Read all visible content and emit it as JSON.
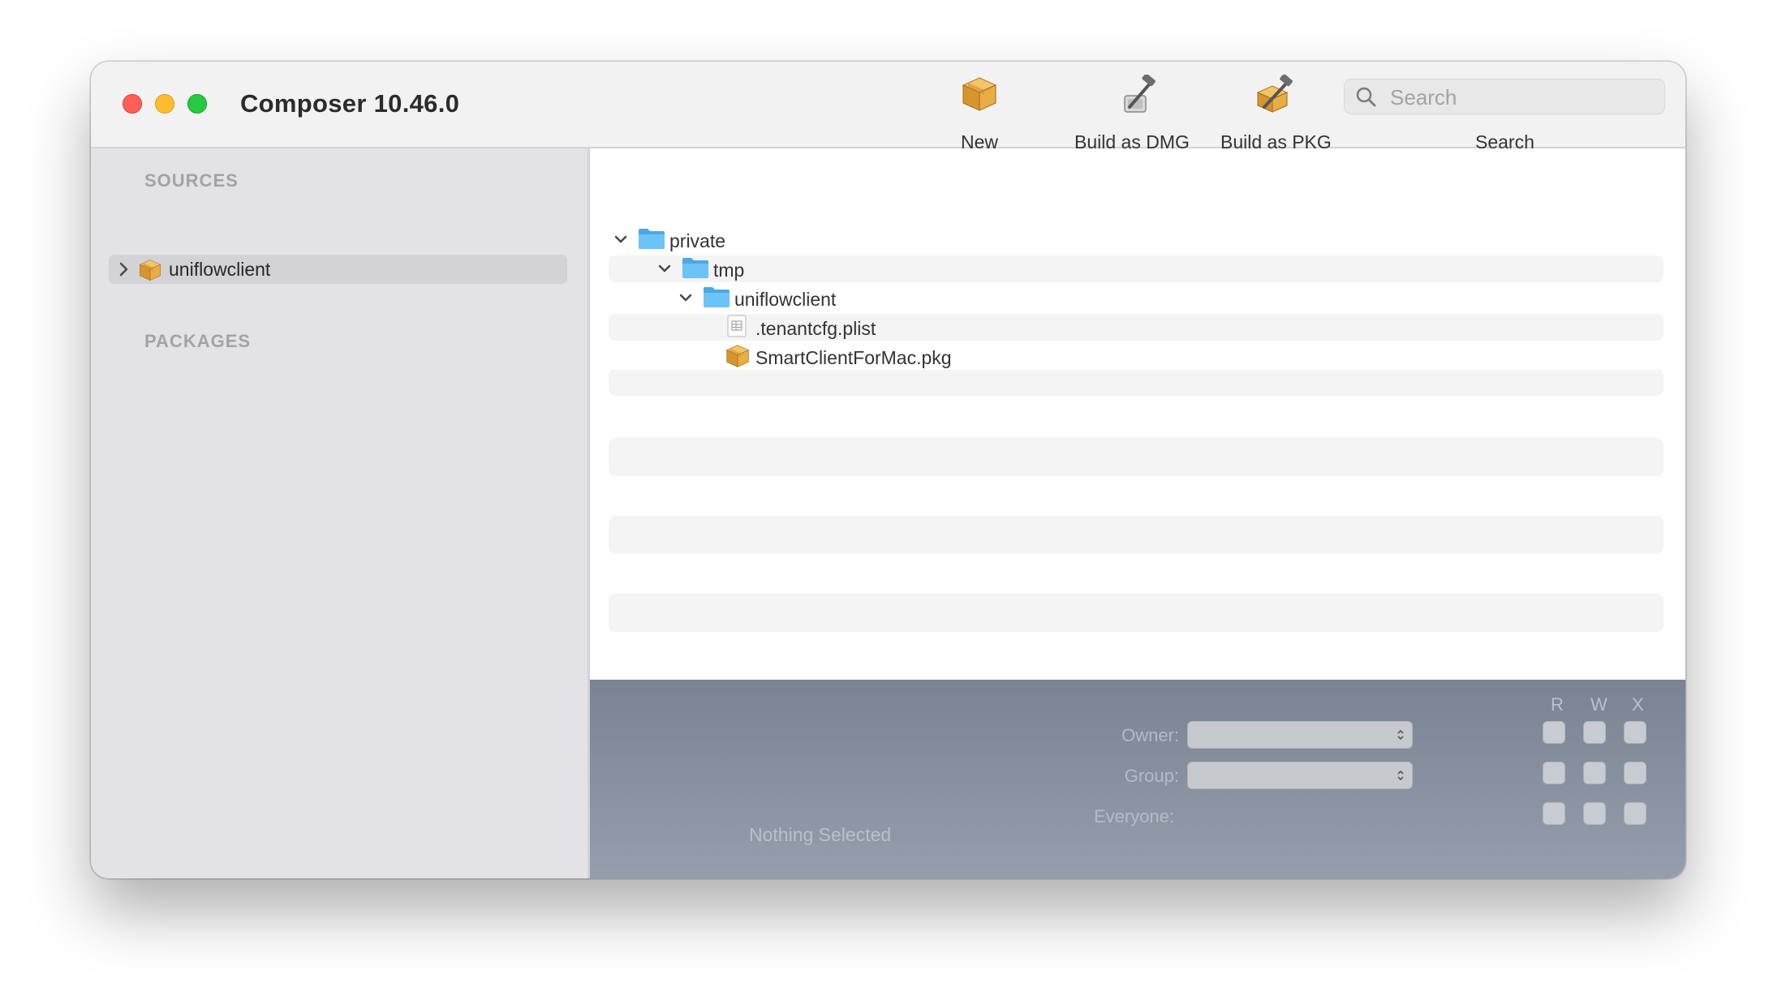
{
  "window": {
    "title": "Composer 10.46.0"
  },
  "toolbar": {
    "new_label": "New",
    "build_dmg_label": "Build as DMG",
    "build_pkg_label": "Build as PKG",
    "search_placeholder": "Search",
    "search_label": "Search"
  },
  "sidebar": {
    "sources_header": "SOURCES",
    "packages_header": "PACKAGES",
    "items": [
      {
        "label": "uniflowclient",
        "icon": "package-icon",
        "expanded": false,
        "selected": true
      }
    ]
  },
  "file_tree": {
    "rows": [
      {
        "label": "private",
        "icon": "folder-icon",
        "expanded": true,
        "depth": 0
      },
      {
        "label": "tmp",
        "icon": "folder-icon",
        "expanded": true,
        "depth": 1
      },
      {
        "label": "uniflowclient",
        "icon": "folder-icon",
        "expanded": true,
        "depth": 2
      },
      {
        "label": ".tenantcfg.plist",
        "icon": "plist-file-icon",
        "depth": 3
      },
      {
        "label": "SmartClientForMac.pkg",
        "icon": "package-icon",
        "depth": 3
      }
    ]
  },
  "permissions": {
    "col_r": "R",
    "col_w": "W",
    "col_x": "X",
    "owner_label": "Owner:",
    "group_label": "Group:",
    "everyone_label": "Everyone:",
    "status": "Nothing Selected"
  },
  "colors": {
    "close": "#fe5f57",
    "minimize": "#febc2e",
    "zoom": "#28c840",
    "folder": "#5ab7f0",
    "package": "#e0a541",
    "permission_panel": "#868f9c"
  }
}
